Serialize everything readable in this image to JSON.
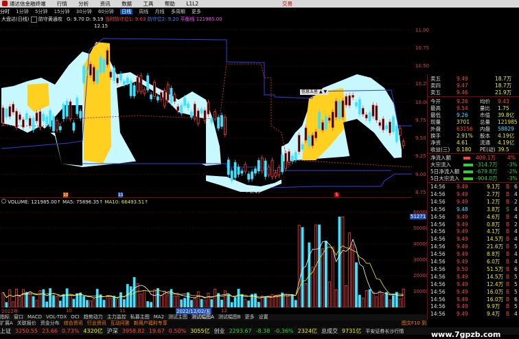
{
  "titlebar": {
    "app": "通达信金融终端",
    "menus": [
      "行情",
      "分析",
      "资讯",
      "数据",
      "工具",
      "帮助"
    ],
    "l1": "L1L2",
    "right": "交易"
  },
  "periodbar": {
    "items": [
      "分时",
      "1分钟",
      "5分钟",
      "15分钟",
      "30分钟",
      "60分钟",
      "日线",
      "周线",
      "月线",
      "多周期",
      "更多"
    ],
    "selected": "日线"
  },
  "kheader": {
    "name": "大盘达(日线)",
    "indicator": "防守黄通攻",
    "g": "G: 9.70",
    "d": "D: 9.19",
    "l1": "当时防守位1: 9.63",
    "l2": "防守位2: 9.20",
    "l3": "平衡线",
    "l4": "121985.00"
  },
  "chart_data": [
    {
      "type": "candlestick-band",
      "title": "",
      "ylim": [
        8.7,
        11.1
      ],
      "yticks": [
        11.0,
        10.75,
        10.5,
        10.25,
        10.0,
        9.75,
        9.5,
        9.25,
        9.0,
        8.75
      ],
      "annotations": [
        "12.15",
        "8.45"
      ],
      "labels_text": [
        "12.15",
        "←8.45"
      ]
    },
    {
      "type": "bar",
      "title": "VOLUME",
      "ylim": [
        0,
        65000
      ],
      "yticks": [
        60000,
        50000,
        40000,
        30000,
        20000,
        10000
      ],
      "legend": [
        "VOLUME: 121985.00",
        "MA5: 75896.35",
        "MA10: 66493.51"
      ],
      "highlight_tick": "51271"
    }
  ],
  "vheader": {
    "v": "VOLUME: 121985.00↑",
    "ma5": "MA5: 75896.35↑",
    "ma10": "MA10: 66493.51↑"
  },
  "popup": {
    "label": "信息五星",
    "btns": [
      "▲",
      "▼"
    ]
  },
  "markers": {
    "m1": "10",
    "m2": "11",
    "m3": "5"
  },
  "quote": {
    "rows": [
      {
        "l": "卖五",
        "p": "9.49",
        "v": "18.7万"
      },
      {
        "l": "卖四",
        "p": "9.47",
        "v": "18.7万"
      },
      {
        "l": "卖五",
        "p": "9.46",
        "v": "21.9万"
      }
    ],
    "info": [
      {
        "a": "今开",
        "b": "9.26",
        "c": "均价",
        "d": "9.43"
      },
      {
        "a": "最高",
        "b": "9.54",
        "c": "量比",
        "d": "1.75"
      },
      {
        "a": "最低",
        "b": "9.26",
        "c": "市值",
        "d": "39.8亿"
      },
      {
        "a": "现量",
        "b": "3701",
        "c": "总量",
        "d": "121985"
      },
      {
        "a": "外盘",
        "b": "63156",
        "c": "内盘",
        "d": "58829"
      },
      {
        "a": "换手",
        "b": "2.91%",
        "c": "股本",
        "d": "4.19亿"
      },
      {
        "a": "净资",
        "b": "4.61",
        "c": "流通",
        "d": "4.19亿"
      },
      {
        "a": "收益(三)",
        "b": "0.180",
        "c": "PE(动)",
        "d": "39.5"
      }
    ],
    "flows": [
      {
        "l": "净流入额",
        "v": "409.1万",
        "p": "4%"
      },
      {
        "l": "大宗流入",
        "v": "-314.7万",
        "p": "-3%"
      },
      {
        "l": "5日净流入额",
        "v": "-679.8万",
        "p": "-2%"
      },
      {
        "l": "5日大宗流入",
        "v": "-904.0万",
        "p": "-3%"
      }
    ],
    "ticks": [
      {
        "t": "14:56",
        "p": "9.49",
        "v": "9.1万",
        "s": "B",
        "n": "6"
      },
      {
        "t": "14:56",
        "p": "9.49",
        "v": "2.7万",
        "s": "B",
        "n": "4"
      },
      {
        "t": "14:56",
        "p": "9.49",
        "v": "1.2万",
        "s": "B",
        "n": "2"
      },
      {
        "t": "14:56",
        "p": "9.48",
        "v": "3.8万",
        "s": "S",
        "n": "4"
      },
      {
        "t": "14:56",
        "p": "9.49",
        "v": "4.6万",
        "s": "B",
        "n": "4"
      },
      {
        "t": "14:56",
        "p": "9.49",
        "v": "0.8万",
        "s": "B",
        "n": "2"
      },
      {
        "t": "14:56",
        "p": "9.49",
        "v": "4.1万",
        "s": "B",
        "n": "4"
      },
      {
        "t": "14:56",
        "p": "9.49",
        "v": "14.5万",
        "s": "B",
        "n": "4"
      },
      {
        "t": "14:56",
        "p": "9.49",
        "v": "21.6万",
        "s": "B",
        "n": "5"
      },
      {
        "t": "14:56",
        "p": "9.49",
        "v": "8.8万",
        "s": "B",
        "n": "4"
      },
      {
        "t": "14:56",
        "p": "9.49",
        "v": "6.0万",
        "s": "B",
        "n": "4"
      },
      {
        "t": "14:56",
        "p": "9.50",
        "v": "51.5万",
        "s": "B",
        "n": "6"
      },
      {
        "t": "14:56",
        "p": "9.49",
        "v": "14.5万",
        "s": "B",
        "n": "5"
      },
      {
        "t": "14:56",
        "p": "9.49",
        "v": "12.4万",
        "s": "B",
        "n": "5"
      },
      {
        "t": "14:56",
        "p": "9.49",
        "v": "16.0万",
        "s": "B",
        "n": "5"
      },
      {
        "t": "14:56",
        "p": "9.49",
        "v": "16.0万",
        "s": "B",
        "n": "6"
      },
      {
        "t": "14:56",
        "p": "9.49",
        "v": "9.9万",
        "s": "B",
        "n": "5"
      },
      {
        "t": "14:56",
        "p": "9.49",
        "v": "9.4万",
        "s": "B",
        "n": "4"
      }
    ]
  },
  "datebar": {
    "left": "2022年",
    "marks": [
      "10",
      "11"
    ],
    "sel": "2022/12/02/五",
    "right": "12"
  },
  "tabbar": [
    "指标",
    "窗口",
    "MACD",
    "VOL-TDX",
    "OCI",
    "趋势动力",
    "主力监控",
    "私募主图",
    "MA2",
    "测试主图",
    "测试幅图A",
    "测试幅图B",
    "更多",
    "设置"
  ],
  "infobar": [
    "扩展A",
    "关联报价",
    "资金分布",
    "综合资讯",
    "行业资讯",
    "互动问答",
    "新用户福利专享"
  ],
  "infobar_right": "图文F10 到",
  "statusbar": [
    {
      "n": "上证",
      "v": "3250.55",
      "c": "23.66",
      "p": "0.73%",
      "a": "4320亿"
    },
    {
      "n": "沪深",
      "v": "3958.82",
      "c": "19.67",
      "p": "0.50%",
      "a": "3055亿"
    },
    {
      "n": "创业",
      "v": "2293.67",
      "c": "-8.38",
      "p": "-0.36%",
      "a": "2324亿"
    },
    {
      "n": "总成交",
      "v": "9731亿",
      "c": "",
      "p": "",
      "a": ""
    }
  ],
  "statusbar_tail": "平安证券长沙行情",
  "watermark": "www.7gpzb.com",
  "colors": {
    "up": "#ff4040",
    "down": "#40e0ff",
    "ma": "#ffffff",
    "ma10": "#f0f000",
    "band": "#ffd020",
    "band2": "#c8f8ff"
  }
}
